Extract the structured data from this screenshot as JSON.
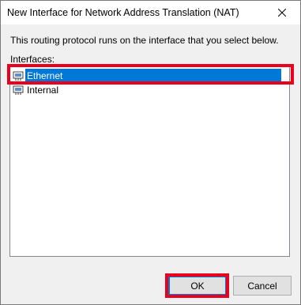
{
  "window": {
    "title": "New Interface for Network Address Translation (NAT)"
  },
  "description": "This routing protocol runs on the interface that you select below.",
  "interfaces": {
    "label": "Interfaces:",
    "items": [
      {
        "label": "Ethernet",
        "selected": true,
        "icon": "network-adapter-icon"
      },
      {
        "label": "Internal",
        "selected": false,
        "icon": "network-adapter-icon"
      }
    ]
  },
  "buttons": {
    "ok_label": "OK",
    "cancel_label": "Cancel"
  },
  "colors": {
    "selection": "#0078d7",
    "annotation_highlight": "#e8001c"
  }
}
